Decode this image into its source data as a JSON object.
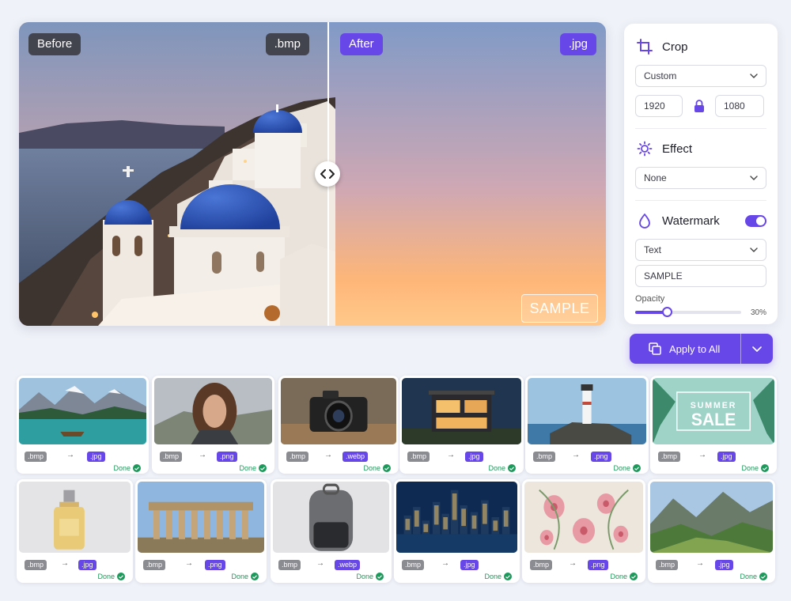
{
  "compare": {
    "before_label": "Before",
    "before_format": ".bmp",
    "after_label": "After",
    "after_format": ".jpg",
    "watermark_text": "SAMPLE"
  },
  "settings": {
    "crop": {
      "title": "Crop",
      "preset": "Custom",
      "width": "1920",
      "height": "1080",
      "aspect_locked": true
    },
    "effect": {
      "title": "Effect",
      "value": "None"
    },
    "watermark": {
      "title": "Watermark",
      "enabled": true,
      "type": "Text",
      "text": "SAMPLE",
      "opacity_label": "Opacity",
      "opacity_value": "30%",
      "opacity": 0.3
    }
  },
  "apply": {
    "label": "Apply to All"
  },
  "files": [
    {
      "from": ".bmp",
      "to": ".jpg",
      "status": "Done",
      "scene": "lake"
    },
    {
      "from": ".bmp",
      "to": ".png",
      "status": "Done",
      "scene": "portrait"
    },
    {
      "from": ".bmp",
      "to": ".webp",
      "status": "Done",
      "scene": "camera"
    },
    {
      "from": ".bmp",
      "to": ".jpg",
      "status": "Done",
      "scene": "house"
    },
    {
      "from": ".bmp",
      "to": ".png",
      "status": "Done",
      "scene": "lighthouse"
    },
    {
      "from": ".bmp",
      "to": ".jpg",
      "status": "Done",
      "scene": "sale",
      "thumb_text": [
        "SUMMER",
        "SALE"
      ]
    },
    {
      "from": ".bmp",
      "to": ".jpg",
      "status": "Done",
      "scene": "perfume"
    },
    {
      "from": ".bmp",
      "to": ".png",
      "status": "Done",
      "scene": "temple"
    },
    {
      "from": ".bmp",
      "to": ".webp",
      "status": "Done",
      "scene": "backpack"
    },
    {
      "from": ".bmp",
      "to": ".jpg",
      "status": "Done",
      "scene": "city"
    },
    {
      "from": ".bmp",
      "to": ".png",
      "status": "Done",
      "scene": "flowers"
    },
    {
      "from": ".bmp",
      "to": ".jpg",
      "status": "Done",
      "scene": "valley"
    }
  ],
  "colors": {
    "accent": "#6847e8",
    "success": "#1d9a5b",
    "label_gray": "#8b8b92"
  }
}
